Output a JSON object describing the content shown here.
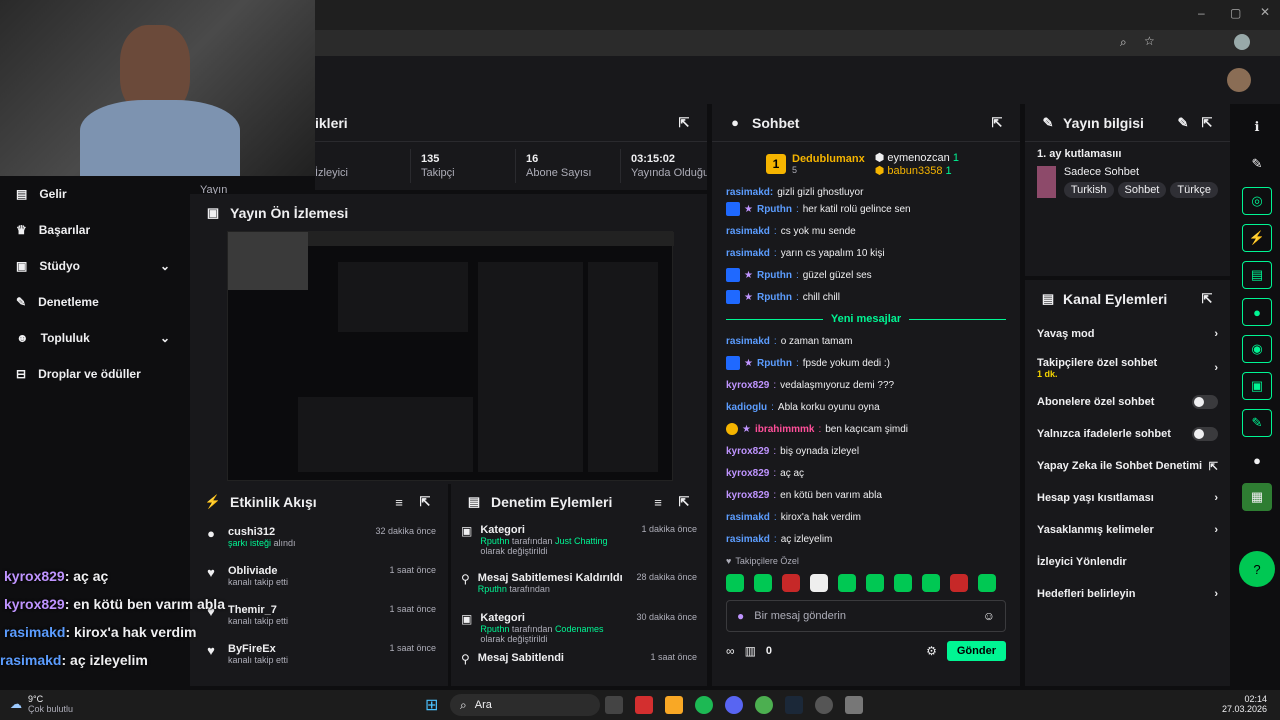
{
  "sidebar": {
    "items": [
      {
        "label": "Gelir"
      },
      {
        "label": "Başarılar"
      },
      {
        "label": "Stüdyo"
      },
      {
        "label": "Denetleme"
      },
      {
        "label": "Topluluk"
      },
      {
        "label": "Droplar ve ödüller"
      }
    ]
  },
  "stats": {
    "title": "ikleri",
    "items": [
      {
        "label": "Yayın",
        "value": ""
      },
      {
        "label": "İzleyici",
        "value": ""
      },
      {
        "label": "Takipçi",
        "value": "135"
      },
      {
        "label": "Abone Sayısı",
        "value": "16"
      },
      {
        "label": "Yayında Olduğu",
        "value": "03:15:02"
      }
    ]
  },
  "preview": {
    "title": "Yayın Ön İzlemesi"
  },
  "activity": {
    "title": "Etkinlik Akışı",
    "items": [
      {
        "name": "cushi312",
        "detail_hl": "şarkı isteği",
        "detail": "alındı",
        "time": "32 dakika önce"
      },
      {
        "name": "Obliviade",
        "detail": "kanalı takip etti",
        "time": "1 saat önce"
      },
      {
        "name": "Themir_7",
        "detail": "kanalı takip etti",
        "time": "1 saat önce"
      },
      {
        "name": "ByFireEx",
        "detail": "kanalı takip etti",
        "time": "1 saat önce"
      }
    ]
  },
  "modactions": {
    "title": "Denetim Eylemleri",
    "items": [
      {
        "title": "Kategori",
        "user": "Rputhn",
        "mid": "tarafından",
        "hl": "Just Chatting",
        "rest": "olarak değiştirildi",
        "time": "1 dakika önce"
      },
      {
        "title": "Mesaj Sabitlemesi Kaldırıldı",
        "user": "Rputhn",
        "mid": "tarafından",
        "hl": "",
        "rest": "",
        "time": "28 dakika önce"
      },
      {
        "title": "Kategori",
        "user": "Rputhn",
        "mid": "tarafından",
        "hl": "Codenames",
        "rest": "olarak değiştirildi",
        "time": "30 dakika önce"
      },
      {
        "title": "Mesaj Sabitlendi",
        "user": "",
        "mid": "",
        "hl": "",
        "rest": "",
        "time": "1 saat önce"
      }
    ]
  },
  "chat": {
    "title": "Sohbet",
    "top": [
      {
        "rank": "1",
        "name": "Dedublumanx",
        "count": "5"
      },
      {
        "name": "eymenozcan",
        "count": "1"
      },
      {
        "name": "babun3358",
        "count": "1"
      }
    ],
    "partial": "gizli gizli ghostluyor",
    "lines": [
      {
        "user": "Rputhn",
        "badges": true,
        "msg": "her katil rolü gelince sen",
        "color": "blue"
      },
      {
        "user": "rasimakd",
        "msg": "cs yok mu sende",
        "color": "blue"
      },
      {
        "user": "rasimakd",
        "msg": "yarın cs yapalım 10 kişi",
        "color": "blue"
      },
      {
        "user": "Rputhn",
        "badges": true,
        "msg": "güzel güzel ses",
        "color": "blue"
      },
      {
        "user": "Rputhn",
        "badges": true,
        "msg": "chill chill",
        "color": "blue"
      }
    ],
    "new_label": "Yeni mesajlar",
    "lines2": [
      {
        "user": "rasimakd",
        "msg": "o zaman tamam",
        "color": "blue"
      },
      {
        "user": "Rputhn",
        "badges": true,
        "msg": "fpsde yokum dedi :)",
        "color": "blue"
      },
      {
        "user": "kyrox829",
        "msg": "vedalaşmıyoruz demi ???",
        "color": "purple"
      },
      {
        "user": "kadioglu",
        "msg": "Abla korku oyunu oyna",
        "color": "blue"
      },
      {
        "user": "ibrahimmmk",
        "badges2": true,
        "msg": "ben kaçıcam şimdi",
        "color": "pink"
      },
      {
        "user": "kyrox829",
        "msg": "biş oynada izleyel",
        "color": "purple"
      },
      {
        "user": "kyrox829",
        "msg": "aç aç",
        "color": "purple"
      },
      {
        "user": "kyrox829",
        "msg": "en kötü ben varım abla",
        "color": "purple"
      },
      {
        "user": "rasimakd",
        "msg": "kirox'a hak verdim",
        "color": "blue"
      },
      {
        "user": "rasimakd",
        "msg": "aç izleyelim",
        "color": "blue"
      }
    ],
    "followers_only": "Takipçilere Özel",
    "placeholder": "Bir mesaj gönderin",
    "points": "0",
    "send": "Gönder"
  },
  "info": {
    "title": "Yayın bilgisi",
    "stream_title": "1. ay kutlamasııı",
    "category": "Sadece Sohbet",
    "tags": [
      "Turkish",
      "Sohbet",
      "Türkçe"
    ]
  },
  "channel": {
    "title": "Kanal Eylemleri",
    "items": [
      {
        "label": "Yavaş mod",
        "type": "arrow"
      },
      {
        "label": "Takipçilere özel sohbet",
        "sub": "1 dk.",
        "type": "arrow"
      },
      {
        "label": "Abonelere özel sohbet",
        "type": "toggle"
      },
      {
        "label": "Yalnızca ifadelerle sohbet",
        "type": "toggle"
      },
      {
        "label": "Yapay Zeka ile Sohbet Denetimi",
        "type": "ext"
      },
      {
        "label": "Hesap yaşı kısıtlaması",
        "type": "arrow"
      },
      {
        "label": "Yasaklanmış kelimeler",
        "type": "arrow"
      },
      {
        "label": "İzleyici Yönlendir",
        "type": "none"
      },
      {
        "label": "Hedefleri belirleyin",
        "type": "arrow"
      }
    ]
  },
  "overlay": [
    {
      "user": "kyrox829",
      "msg": ": aç aç",
      "color": "purple"
    },
    {
      "user": "kyrox829",
      "msg": ": en kötü ben varım abla",
      "color": "purple"
    },
    {
      "user": "rasimakd",
      "msg": ": kirox'a hak verdim",
      "color": "blue"
    },
    {
      "user": "rasimakd",
      "msg": ": aç izleyelim",
      "color": "blue"
    }
  ],
  "taskbar": {
    "weather": "9°C",
    "weather_desc": "Çok bulutlu",
    "search": "Ara",
    "time": "02:14",
    "date": "27.03.2026"
  }
}
